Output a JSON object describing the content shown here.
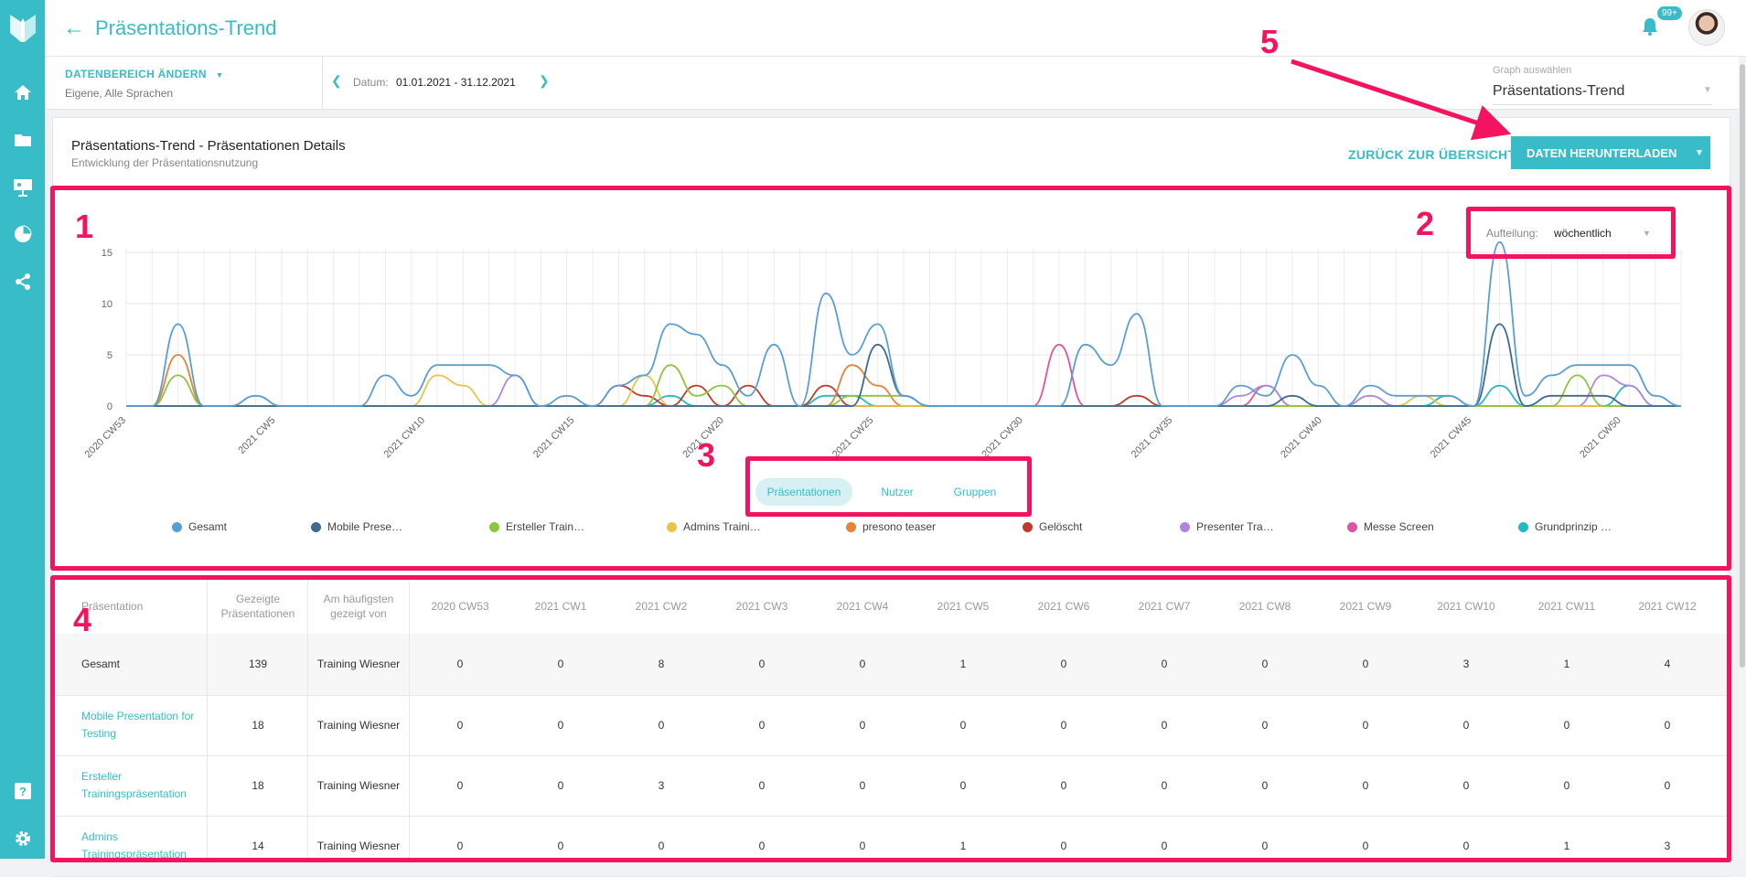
{
  "header": {
    "title": "Präsentations-Trend",
    "notification_badge": "99+"
  },
  "filters": {
    "range_button": "DATENBEREICH ÄNDERN",
    "range_sub": "Eigene, Alle Sprachen",
    "date_label": "Datum:",
    "date_value": "01.01.2021 - 31.12.2021",
    "graph_select_label": "Graph auswählen",
    "graph_select_value": "Präsentations-Trend"
  },
  "card": {
    "title": "Präsentations-Trend - Präsentationen Details",
    "subtitle": "Entwicklung der Präsentationsnutzung",
    "back_link": "ZURÜCK ZUR ÜBERSICHT",
    "download_button": "DATEN HERUNTERLADEN"
  },
  "aufteilung": {
    "label": "Aufteilung:",
    "value": "wöchentlich"
  },
  "tabs": [
    "Präsentationen",
    "Nutzer",
    "Gruppen"
  ],
  "chart_data": {
    "type": "line",
    "y_ticks": [
      "0",
      "5",
      "10",
      "15"
    ],
    "ylim": [
      0,
      15
    ],
    "x_tick_labels": [
      "2020 CW53",
      "2021 CW5",
      "2021 CW10",
      "2021 CW15",
      "2021 CW20",
      "2021 CW25",
      "2021 CW30",
      "2021 CW35",
      "2021 CW40",
      "2021 CW45",
      "2021 CW50"
    ],
    "x_tick_weeks": [
      0,
      5,
      10,
      15,
      20,
      25,
      30,
      35,
      40,
      45,
      50
    ],
    "week_count": 53,
    "series": [
      {
        "name": "Gesamt",
        "color": "#5a9fd4",
        "values": [
          0,
          0,
          8,
          0,
          0,
          1,
          0,
          0,
          0,
          0,
          3,
          1,
          4,
          4,
          4,
          3,
          0,
          1,
          0,
          2,
          3,
          8,
          7,
          4,
          1,
          6,
          0,
          11,
          5,
          8,
          1,
          0,
          0,
          0,
          0,
          0,
          0,
          6,
          4,
          9,
          0,
          0,
          0,
          2,
          1,
          5,
          2,
          0,
          2,
          1,
          1,
          1,
          0,
          16,
          1,
          3,
          4,
          4,
          4,
          1,
          0
        ]
      },
      {
        "name": "Mobile Prese…",
        "color": "#3d6a96",
        "values": [
          0,
          0,
          0,
          0,
          0,
          0,
          0,
          0,
          0,
          0,
          0,
          0,
          0,
          0,
          0,
          0,
          0,
          0,
          0,
          0,
          0,
          0,
          0,
          0,
          0,
          0,
          0,
          0,
          0,
          6,
          1,
          0,
          0,
          0,
          0,
          0,
          0,
          0,
          0,
          0,
          0,
          0,
          0,
          0,
          0,
          1,
          0,
          0,
          0,
          0,
          0,
          0,
          0,
          8,
          0,
          1,
          1,
          1,
          0,
          0,
          0
        ]
      },
      {
        "name": "Ersteller Train…",
        "color": "#8cc63f",
        "values": [
          0,
          0,
          3,
          0,
          0,
          0,
          0,
          0,
          0,
          0,
          0,
          0,
          0,
          0,
          0,
          0,
          0,
          0,
          0,
          0,
          0,
          4,
          1,
          2,
          0,
          0,
          0,
          0,
          1,
          1,
          1,
          0,
          0,
          0,
          0,
          0,
          0,
          0,
          0,
          0,
          0,
          0,
          0,
          0,
          0,
          0,
          0,
          0,
          0,
          0,
          0,
          0,
          0,
          0,
          0,
          0,
          3,
          0,
          0,
          0,
          0
        ]
      },
      {
        "name": "Admins Traini…",
        "color": "#e8c547",
        "values": [
          0,
          0,
          0,
          0,
          0,
          1,
          0,
          0,
          0,
          0,
          0,
          0,
          3,
          2,
          0,
          0,
          0,
          0,
          0,
          0,
          3,
          0,
          0,
          0,
          0,
          0,
          0,
          0,
          0,
          0,
          0,
          0,
          0,
          0,
          0,
          0,
          0,
          0,
          0,
          0,
          0,
          0,
          0,
          0,
          0,
          0,
          0,
          0,
          0,
          0,
          1,
          0,
          0,
          0,
          0,
          0,
          0,
          0,
          0,
          0,
          0
        ]
      },
      {
        "name": "presono teaser",
        "color": "#e8813a",
        "values": [
          0,
          0,
          5,
          0,
          0,
          0,
          0,
          0,
          0,
          0,
          0,
          0,
          0,
          0,
          0,
          0,
          0,
          0,
          0,
          0,
          0,
          0,
          0,
          0,
          0,
          0,
          0,
          0,
          4,
          2,
          0,
          0,
          0,
          0,
          0,
          0,
          0,
          0,
          0,
          0,
          0,
          0,
          0,
          0,
          0,
          0,
          0,
          0,
          0,
          0,
          0,
          0,
          0,
          0,
          0,
          0,
          0,
          0,
          0,
          0,
          0
        ]
      },
      {
        "name": "Gelöscht",
        "color": "#c0392b",
        "values": [
          0,
          0,
          0,
          0,
          0,
          0,
          0,
          0,
          0,
          0,
          0,
          0,
          0,
          0,
          0,
          0,
          0,
          0,
          0,
          2,
          1,
          0,
          2,
          0,
          2,
          0,
          0,
          2,
          0,
          0,
          0,
          0,
          0,
          0,
          0,
          0,
          0,
          0,
          0,
          1,
          0,
          0,
          0,
          0,
          0,
          0,
          0,
          0,
          0,
          0,
          0,
          0,
          0,
          0,
          0,
          0,
          0,
          0,
          0,
          0,
          0
        ]
      },
      {
        "name": "Presenter Tra…",
        "color": "#b185db",
        "values": [
          0,
          0,
          0,
          0,
          0,
          0,
          0,
          0,
          0,
          0,
          0,
          0,
          0,
          0,
          0,
          3,
          0,
          0,
          0,
          0,
          0,
          0,
          0,
          0,
          0,
          0,
          0,
          0,
          0,
          0,
          0,
          0,
          0,
          0,
          0,
          0,
          0,
          0,
          0,
          0,
          0,
          0,
          0,
          1,
          2,
          0,
          0,
          0,
          1,
          0,
          0,
          0,
          0,
          0,
          0,
          0,
          0,
          3,
          2,
          0,
          0
        ]
      },
      {
        "name": "Messe Screen",
        "color": "#e0559e",
        "values": [
          0,
          0,
          0,
          0,
          0,
          0,
          0,
          0,
          0,
          0,
          0,
          0,
          0,
          0,
          0,
          0,
          0,
          0,
          0,
          0,
          0,
          0,
          0,
          0,
          0,
          0,
          0,
          0,
          0,
          0,
          0,
          0,
          0,
          0,
          0,
          0,
          6,
          0,
          0,
          0,
          0,
          0,
          0,
          0,
          2,
          0,
          0,
          0,
          0,
          0,
          0,
          0,
          0,
          0,
          0,
          0,
          0,
          0,
          0,
          0,
          0
        ]
      },
      {
        "name": "Grundprinzip …",
        "color": "#26b8c4",
        "values": [
          0,
          0,
          0,
          0,
          0,
          0,
          0,
          0,
          0,
          0,
          0,
          0,
          0,
          0,
          0,
          0,
          0,
          0,
          0,
          0,
          0,
          1,
          0,
          0,
          0,
          0,
          0,
          1,
          1,
          0,
          0,
          0,
          0,
          0,
          0,
          0,
          0,
          0,
          0,
          0,
          0,
          0,
          0,
          0,
          0,
          0,
          0,
          0,
          0,
          0,
          0,
          1,
          0,
          2,
          0,
          0,
          0,
          0,
          2,
          0,
          0
        ]
      }
    ]
  },
  "table": {
    "headers": [
      "Präsentation",
      "Gezeigte Präsentationen",
      "Am häufigsten gezeigt von",
      "2020 CW53",
      "2021 CW1",
      "2021 CW2",
      "2021 CW3",
      "2021 CW4",
      "2021 CW5",
      "2021 CW6",
      "2021 CW7",
      "2021 CW8",
      "2021 CW9",
      "2021 CW10",
      "2021 CW11",
      "2021 CW12"
    ],
    "rows": [
      {
        "name": "Gesamt",
        "shown": "139",
        "by": "Training Wiesner",
        "weeks": [
          "0",
          "0",
          "8",
          "0",
          "0",
          "1",
          "0",
          "0",
          "0",
          "0",
          "3",
          "1",
          "4"
        ]
      },
      {
        "name": "Mobile Presentation for Testing",
        "shown": "18",
        "by": "Training Wiesner",
        "weeks": [
          "0",
          "0",
          "0",
          "0",
          "0",
          "0",
          "0",
          "0",
          "0",
          "0",
          "0",
          "0",
          "0"
        ]
      },
      {
        "name": "Ersteller Trainingspräsentation",
        "shown": "18",
        "by": "Training Wiesner",
        "weeks": [
          "0",
          "0",
          "3",
          "0",
          "0",
          "0",
          "0",
          "0",
          "0",
          "0",
          "0",
          "0",
          "0"
        ]
      },
      {
        "name": "Admins Trainingspräsentation",
        "shown": "14",
        "by": "Training Wiesner",
        "weeks": [
          "0",
          "0",
          "0",
          "0",
          "0",
          "1",
          "0",
          "0",
          "0",
          "0",
          "0",
          "1",
          "3"
        ]
      }
    ]
  },
  "annotations": [
    "1",
    "2",
    "3",
    "4",
    "5"
  ],
  "colors": {
    "accent": "#37bcc8",
    "annotation": "#f3135e"
  }
}
